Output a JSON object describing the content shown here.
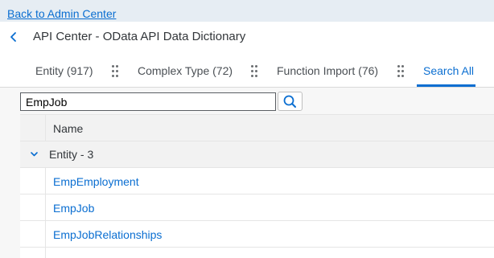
{
  "topbar": {
    "back_link": "Back to Admin Center"
  },
  "header": {
    "title": "API Center - OData API Data Dictionary"
  },
  "tabs": [
    {
      "label": "Entity (917)"
    },
    {
      "label": "Complex Type (72)"
    },
    {
      "label": "Function Import (76)"
    },
    {
      "label": "Search All"
    }
  ],
  "search": {
    "value": "EmpJob"
  },
  "table": {
    "column_header": "Name",
    "group_label": "Entity - 3",
    "rows": [
      "EmpEmployment",
      "EmpJob",
      "EmpJobRelationships"
    ]
  },
  "colors": {
    "accent": "#0a6ed1",
    "text": "#32363a",
    "background": "#f7f7f7"
  },
  "icons": [
    "chevron-left-icon",
    "drag-handle-icon",
    "search-icon",
    "chevron-down-icon"
  ]
}
